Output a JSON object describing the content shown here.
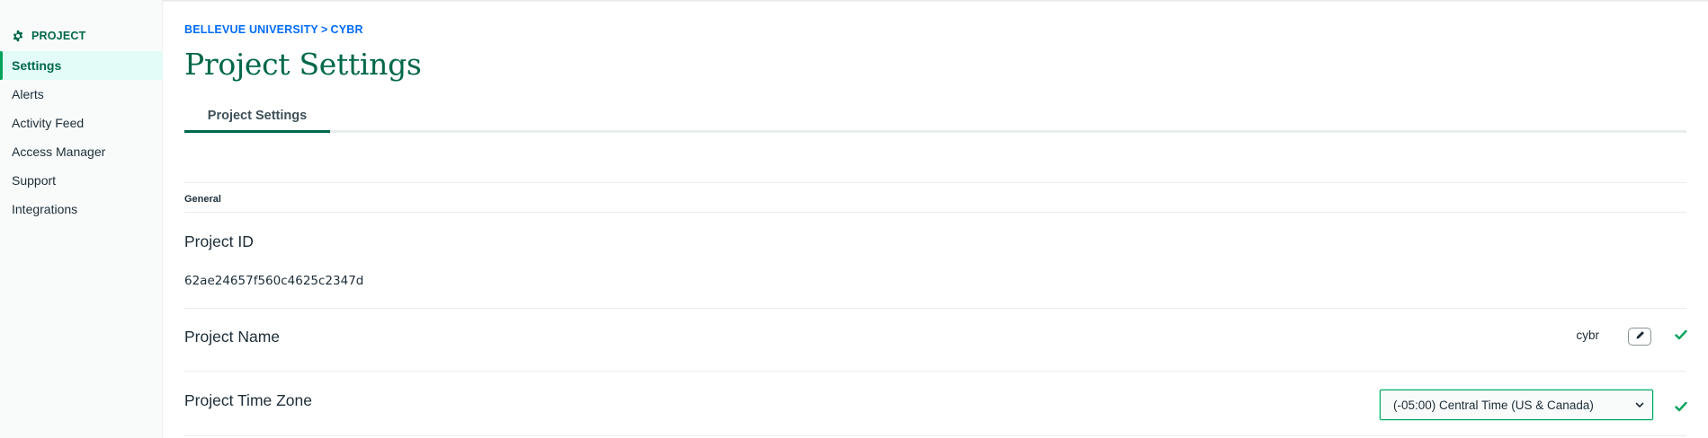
{
  "sidebar": {
    "header": {
      "label": "PROJECT",
      "icon": "gear-icon",
      "color": "#00684a"
    },
    "items": [
      {
        "label": "Settings",
        "active": true
      },
      {
        "label": "Alerts",
        "active": false
      },
      {
        "label": "Activity Feed",
        "active": false
      },
      {
        "label": "Access Manager",
        "active": false
      },
      {
        "label": "Support",
        "active": false
      },
      {
        "label": "Integrations",
        "active": false
      }
    ]
  },
  "breadcrumb": {
    "org": "BELLEVUE UNIVERSITY",
    "separator": ">",
    "project": "CYBR"
  },
  "page": {
    "title": "Project Settings"
  },
  "tabs": [
    {
      "label": "Project Settings",
      "active": true
    }
  ],
  "general": {
    "section_label": "General",
    "project_id": {
      "label": "Project ID",
      "value": "62ae24657f560c4625c2347d"
    },
    "project_name": {
      "label": "Project Name",
      "value": "cybr",
      "edit_icon": "pencil-icon",
      "status_icon": "checkmark-icon"
    },
    "project_time_zone": {
      "label": "Project Time Zone",
      "selected": "(-05:00) Central Time (US & Canada)",
      "dropdown_icon": "chevron-down-icon",
      "status_icon": "checkmark-icon"
    }
  },
  "colors": {
    "accent": "#00684a",
    "link": "#016bf8",
    "success": "#00a35c"
  }
}
